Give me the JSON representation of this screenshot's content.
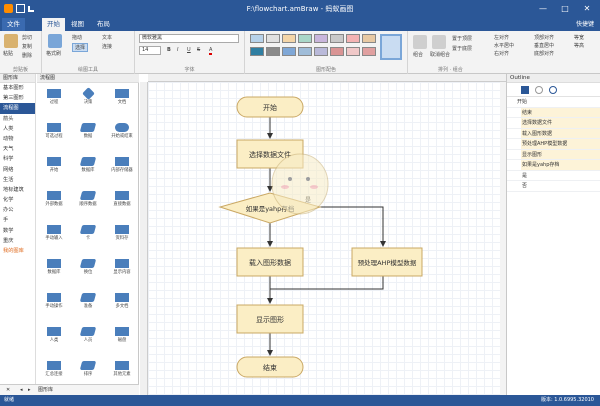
{
  "titlebar": {
    "title": "F:\\flowchart.amBraw - 蚂蚁画图"
  },
  "menu": {
    "file": "文件",
    "items": [
      "开始",
      "视图",
      "布局"
    ],
    "active": 0,
    "right": "快捷键"
  },
  "ribbon": {
    "clipboard": {
      "paste": "粘贴",
      "cut": "剪切",
      "copy": "复制",
      "delete": "删除",
      "label": "剪贴板"
    },
    "tools": {
      "select": "选择",
      "connect": "连接",
      "text": "文本",
      "pan": "拖动",
      "format_painter": "格式刷",
      "label": "绘图工具"
    },
    "font": {
      "family": "微软雅黑",
      "size": "14",
      "bold": "B",
      "italic": "I",
      "underline": "U",
      "strike": "S",
      "color": "A",
      "label": "字体"
    },
    "styles": {
      "label": "图形配色",
      "colors": [
        "#b7d2ea",
        "#e1e1e1",
        "#f5d6a8",
        "#a9d7c8",
        "#c9b6dc",
        "#c9c9c9",
        "#f3b3b3",
        "#e8c9a3",
        "#2f7ea1",
        "#8a8a8a",
        "#7fa7d6",
        "#9fbcd8",
        "#b9b9d9",
        "#d99494",
        "#f0c8c8",
        "#e0a0a0"
      ]
    },
    "arrange": {
      "label": "组合",
      "group": "组合",
      "ungroup": "取消组合",
      "bring_front": "置于顶层",
      "send_back": "置于底层",
      "align_left": "左对齐",
      "align_center": "水平居中",
      "align_right": "右对齐",
      "align_top": "顶部对齐",
      "align_middle": "垂直居中",
      "align_bottom": "底部对齐",
      "same_width": "等宽",
      "same_height": "等高",
      "label2": "排列 · 组合"
    }
  },
  "left_panel": {
    "categories_header": "图形库",
    "categories": [
      "基本图形",
      "第三图形",
      "流程图",
      "箭头",
      "人类",
      "动物",
      "天气",
      "科学",
      "网络",
      "生活",
      "地标建筑",
      "化学",
      "办公",
      "手",
      "数学",
      "重庆",
      "我的图库"
    ],
    "selected_category": 2,
    "shapes_header": "流程图",
    "shapes": [
      "过程",
      "决策",
      "文档",
      "可选过程",
      "数据",
      "开始或结束",
      "开始",
      "数据库",
      "内部存储器",
      "外部数据",
      "顺序数据",
      "直接数据",
      "手动输入",
      "卡",
      "资料存",
      "数据库",
      "换位",
      "显示内容",
      "手动操作",
      "准备",
      "多文档",
      "人类",
      "人员",
      "磁盘",
      "汇总连接",
      "排序",
      "其他元素"
    ],
    "bottom_tab": "图形库"
  },
  "canvas": {
    "nodes": {
      "start": "开始",
      "select_file": "选择数据文件",
      "decision": "如果是yahp存档",
      "load": "载入图形数据",
      "preprocess": "预处理AHP模型数据",
      "show": "显示图形",
      "end": "结束"
    },
    "edge_label": "是"
  },
  "outline": {
    "title": "Outline",
    "items": [
      "开始",
      "结束",
      "选择数据文件",
      "载入图形数据",
      "预处理AHP模型数据",
      "显示图形",
      "如果是yahp存档",
      "是",
      "否"
    ]
  },
  "statusbar": {
    "left": "就绪",
    "right": "版本: 1.0.6995.32010"
  }
}
